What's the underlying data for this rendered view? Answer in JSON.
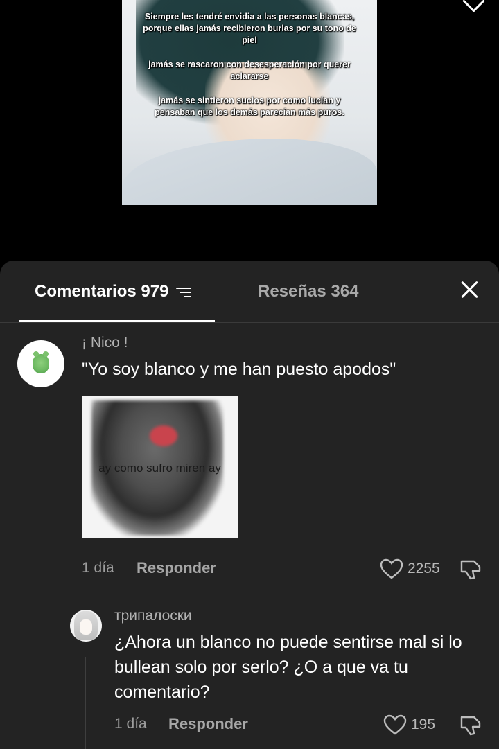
{
  "video": {
    "overlay_lines": [
      "Siempre les tendré envidia a las personas blancas, porque ellas jamás recibieron burlas por su tono de piel",
      "jamás se rascaron con desesperación por querer aclararse",
      "jamás se sintieron sucios por como lucían y pensaban  que los demás parecían más puros."
    ]
  },
  "tabs": {
    "comments_label": "Comentarios 979",
    "reviews_label": "Reseñas 364"
  },
  "comments": [
    {
      "username": "¡ Nico !",
      "text": "\"Yo soy blanco y me han puesto apodos\"",
      "image_caption": "ay como sufro miren ay",
      "time": "1 día",
      "reply_label": "Responder",
      "likes": "2255"
    }
  ],
  "replies": [
    {
      "username": "трипалоски",
      "text": "¿Ahora un blanco no puede sentirse mal si lo bullean solo por serlo? ¿O a que va tu comentario?",
      "time": "1 día",
      "reply_label": "Responder",
      "likes": "195"
    }
  ],
  "icons": {
    "filter": "filter-icon",
    "close": "close-icon",
    "like": "heart-icon",
    "dislike": "dislike-icon"
  },
  "colors": {
    "sheet_bg": "#232323",
    "text_primary": "#ffffff",
    "text_secondary": "#9d9d9d"
  }
}
